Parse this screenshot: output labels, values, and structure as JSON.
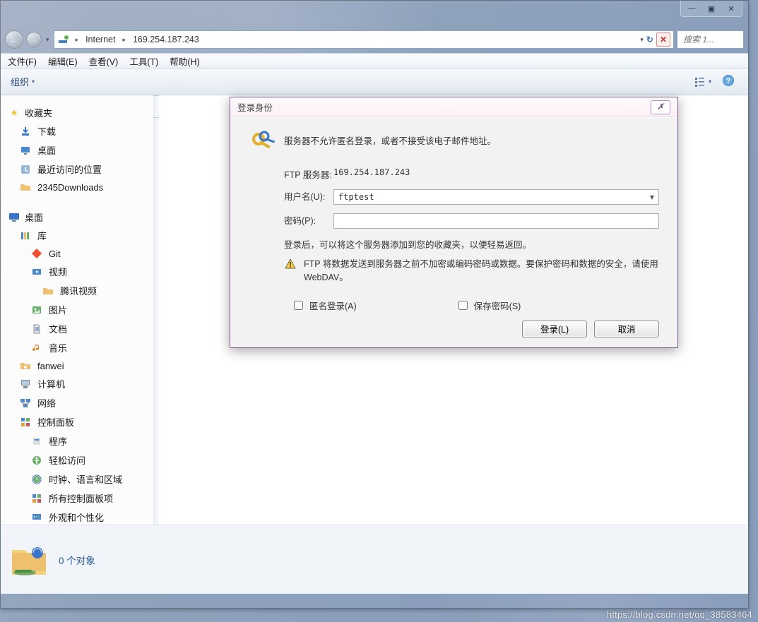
{
  "window_controls": {
    "minimize": "—",
    "maximize": "▣",
    "close": "✕"
  },
  "nav": {
    "back_glyph": "←",
    "fwd_glyph": "→",
    "dropdown_glyph": "▾",
    "path_icon_label": "🌐",
    "seg1": "Internet",
    "seg2": "169.254.187.243",
    "refresh_glyph": "↻",
    "stop_glyph": "✕",
    "search_placeholder": "搜索 1..."
  },
  "menus": {
    "file": "文件(F)",
    "edit": "编辑(E)",
    "view": "查看(V)",
    "tools": "工具(T)",
    "help": "帮助(H)"
  },
  "toolbar": {
    "organize": "组织",
    "dropdown_glyph": "▾",
    "views_glyph": "▦",
    "help_glyph": "❔"
  },
  "sidebar": {
    "favorites": "收藏夹",
    "downloads": "下载",
    "desktop1": "桌面",
    "recent": "最近访问的位置",
    "dl2345": "2345Downloads",
    "desktop2": "桌面",
    "libraries": "库",
    "git": "Git",
    "videos": "视频",
    "tencent_video": "腾讯视频",
    "pictures": "图片",
    "documents": "文档",
    "music": "音乐",
    "fanwei": "fanwei",
    "computer": "计算机",
    "network": "网络",
    "control_panel": "控制面板",
    "programs": "程序",
    "ease": "轻松访问",
    "clock": "时钟、语言和区域",
    "all_cp": "所有控制面板项",
    "appearance": "外观和个性化"
  },
  "dialog": {
    "title": "登录身份",
    "close_glyph": "✗",
    "msg1": "服务器不允许匿名登录，或者不接受该电子邮件地址。",
    "ftp_server_label": "FTP 服务器:",
    "ftp_server_value": "169.254.187.243",
    "user_label": "用户名(U):",
    "user_value": "ftptest",
    "pass_label": "密码(P):",
    "pass_value": "",
    "info1": "登录后，可以将这个服务器添加到您的收藏夹，以便轻易返回。",
    "warn": "FTP 将数据发送到服务器之前不加密或编码密码或数据。要保护密码和数据的安全，请使用 WebDAV。",
    "anon": "匿名登录(A)",
    "save_pw": "保存密码(S)",
    "login_btn": "登录(L)",
    "cancel_btn": "取消"
  },
  "status": {
    "text": "0 个对象"
  },
  "watermark": "https://blog.csdn.net/qq_38583464"
}
